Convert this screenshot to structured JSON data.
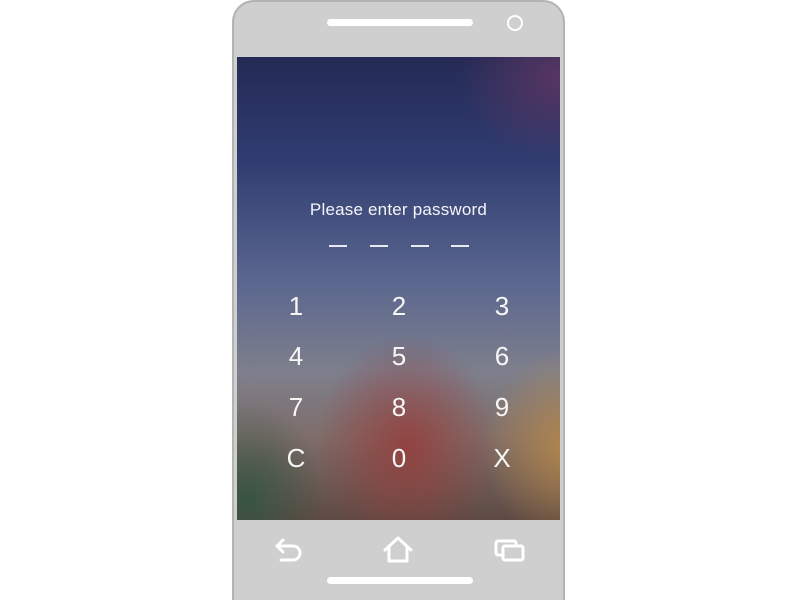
{
  "lock_screen": {
    "prompt": "Please enter password",
    "pin_length": 4,
    "keypad": [
      {
        "label": "1",
        "name": "key-1"
      },
      {
        "label": "2",
        "name": "key-2"
      },
      {
        "label": "3",
        "name": "key-3"
      },
      {
        "label": "4",
        "name": "key-4"
      },
      {
        "label": "5",
        "name": "key-5"
      },
      {
        "label": "6",
        "name": "key-6"
      },
      {
        "label": "7",
        "name": "key-7"
      },
      {
        "label": "8",
        "name": "key-8"
      },
      {
        "label": "9",
        "name": "key-9"
      },
      {
        "label": "C",
        "name": "key-clear"
      },
      {
        "label": "0",
        "name": "key-0"
      },
      {
        "label": "X",
        "name": "key-cancel"
      }
    ]
  },
  "nav_bar": {
    "icons": [
      "back-icon",
      "home-icon",
      "recent-apps-icon"
    ]
  },
  "colors": {
    "phone_body": "#cfcfcf",
    "text": "#f4f4f8"
  }
}
